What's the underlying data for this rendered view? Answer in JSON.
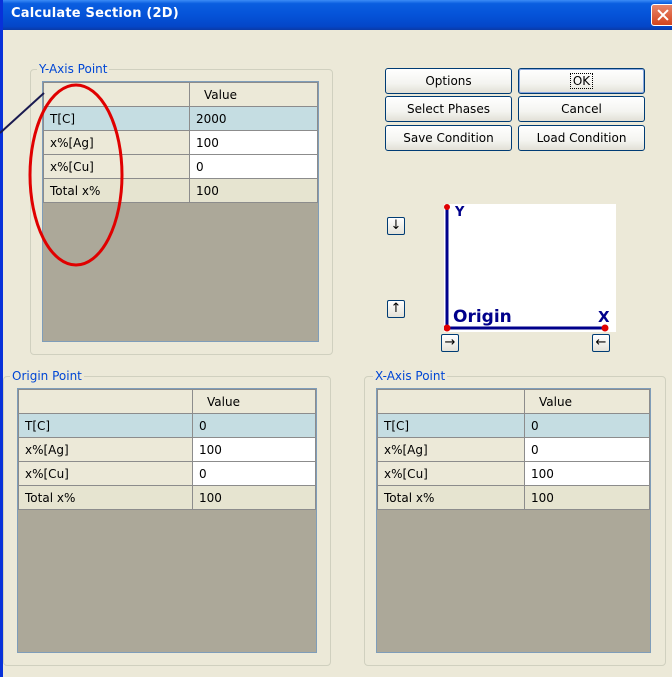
{
  "window": {
    "title": "Calculate Section (2D)"
  },
  "buttons": {
    "options": "Options",
    "ok": "OK",
    "select_phases": "Select Phases",
    "cancel": "Cancel",
    "save_condition": "Save Condition",
    "load_condition": "Load Condition"
  },
  "plot": {
    "y_label": "Y",
    "x_label": "X",
    "origin_label": "Origin"
  },
  "arrows": {
    "down": "↓",
    "up": "↑",
    "right": "→",
    "left": "←"
  },
  "y_axis": {
    "label": "Y-Axis Point",
    "header": "Value",
    "rows": [
      {
        "name": "T[C]",
        "value": "2000"
      },
      {
        "name": "x%[Ag]",
        "value": "100"
      },
      {
        "name": "x%[Cu]",
        "value": "0"
      },
      {
        "name": "Total x%",
        "value": "100"
      }
    ]
  },
  "origin": {
    "label": "Origin Point",
    "header": "Value",
    "rows": [
      {
        "name": "T[C]",
        "value": "0"
      },
      {
        "name": "x%[Ag]",
        "value": "100"
      },
      {
        "name": "x%[Cu]",
        "value": "0"
      },
      {
        "name": "Total x%",
        "value": "100"
      }
    ]
  },
  "x_axis": {
    "label": "X-Axis Point",
    "header": "Value",
    "rows": [
      {
        "name": "T[C]",
        "value": "0"
      },
      {
        "name": "x%[Ag]",
        "value": "0"
      },
      {
        "name": "x%[Cu]",
        "value": "100"
      },
      {
        "name": "Total x%",
        "value": "100"
      }
    ]
  },
  "colors": {
    "title_bar": "#0553d8",
    "group_label": "#0046d5",
    "highlight_row": "#c5dde2",
    "annotation": "#e00000",
    "plot_axis": "#00008b",
    "plot_point": "#e00000"
  }
}
